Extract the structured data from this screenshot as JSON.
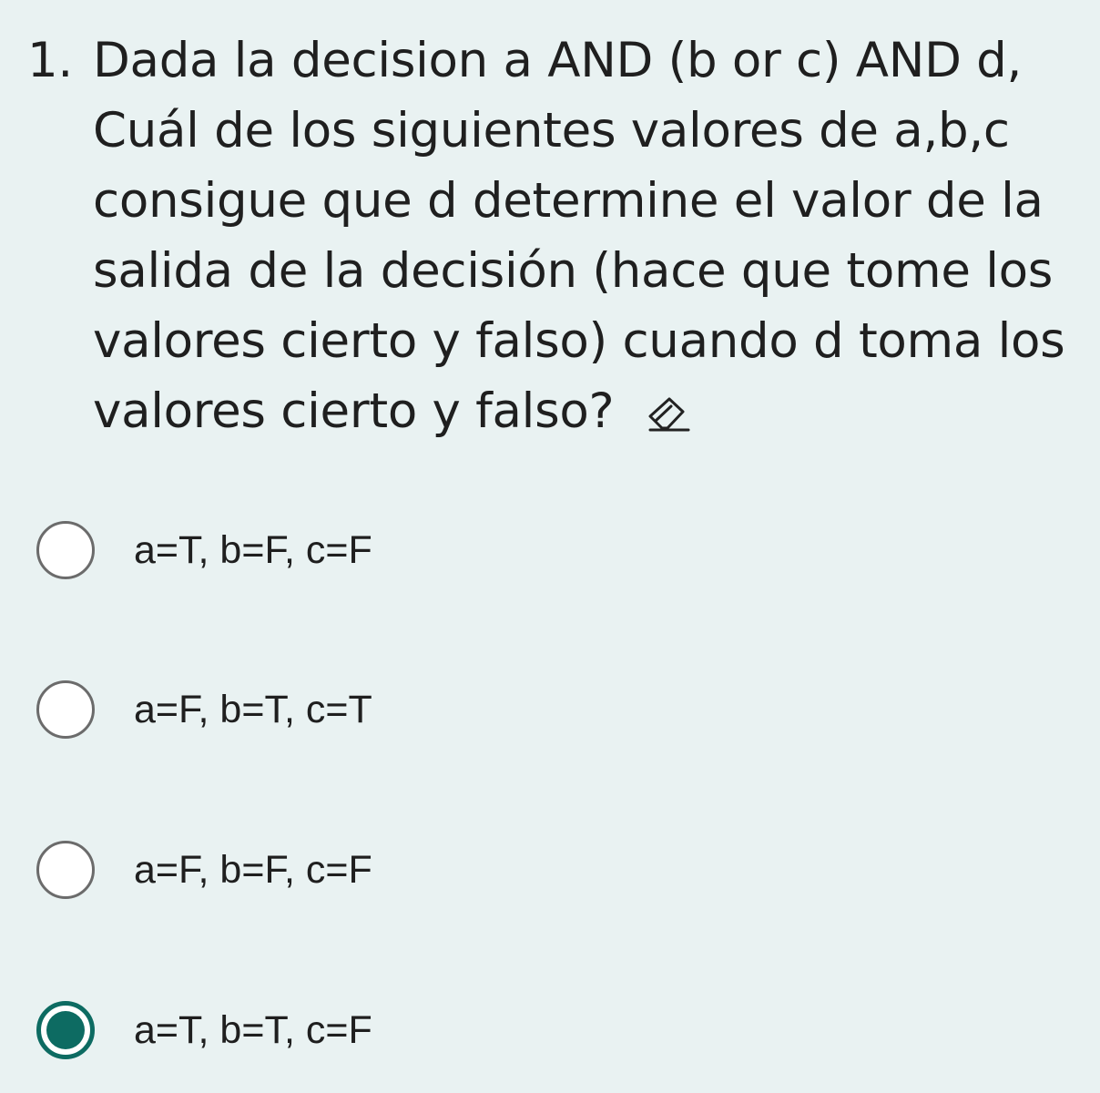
{
  "question": {
    "number": "1.",
    "text": "Dada la decision a AND (b or c) AND d, Cuál de los siguientes valores de a,b,c consigue que d determine el valor de la salida de la decisión (hace que tome los valores cierto y falso) cuando d toma los valores cierto y falso?",
    "icon": "eraser-icon"
  },
  "options": [
    {
      "label": "a=T, b=F, c=F",
      "selected": false
    },
    {
      "label": "a=F, b=T, c=T",
      "selected": false
    },
    {
      "label": "a=F, b=F, c=F",
      "selected": false
    },
    {
      "label": "a=T, b=T, c=F",
      "selected": true
    }
  ],
  "colors": {
    "background": "#e9f2f2",
    "accent": "#0d6b62",
    "text": "#1f1f1f",
    "radio_border": "#6b6b6b"
  }
}
